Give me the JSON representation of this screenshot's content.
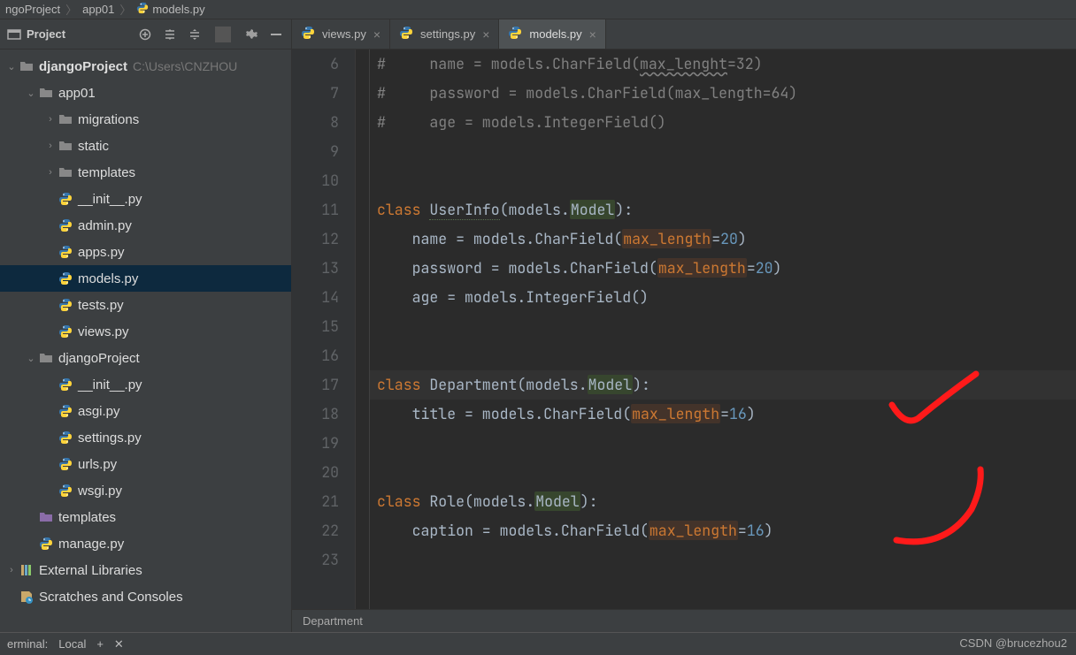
{
  "breadcrumb": {
    "project": "ngoProject",
    "folder": "app01",
    "file": "models.py"
  },
  "sidebar": {
    "title": "Project",
    "root": "djangoProject",
    "root_path": "C:\\Users\\CNZHOU",
    "items": [
      {
        "label": "djangoProject",
        "type": "folder",
        "indent": 0,
        "arrow": "v",
        "bold": true
      },
      {
        "label": "app01",
        "type": "folder",
        "indent": 1,
        "arrow": "v"
      },
      {
        "label": "migrations",
        "type": "folder",
        "indent": 2,
        "arrow": ">"
      },
      {
        "label": "static",
        "type": "folder",
        "indent": 2,
        "arrow": ">"
      },
      {
        "label": "templates",
        "type": "folder",
        "indent": 2,
        "arrow": ">"
      },
      {
        "label": "__init__.py",
        "type": "py",
        "indent": 2
      },
      {
        "label": "admin.py",
        "type": "py",
        "indent": 2
      },
      {
        "label": "apps.py",
        "type": "py",
        "indent": 2
      },
      {
        "label": "models.py",
        "type": "py",
        "indent": 2,
        "selected": true
      },
      {
        "label": "tests.py",
        "type": "py",
        "indent": 2
      },
      {
        "label": "views.py",
        "type": "py",
        "indent": 2
      },
      {
        "label": "djangoProject",
        "type": "folder",
        "indent": 1,
        "arrow": "v"
      },
      {
        "label": "__init__.py",
        "type": "py",
        "indent": 2
      },
      {
        "label": "asgi.py",
        "type": "py",
        "indent": 2
      },
      {
        "label": "settings.py",
        "type": "py",
        "indent": 2
      },
      {
        "label": "urls.py",
        "type": "py",
        "indent": 2
      },
      {
        "label": "wsgi.py",
        "type": "py",
        "indent": 2
      },
      {
        "label": "templates",
        "type": "dir",
        "indent": 1
      },
      {
        "label": "manage.py",
        "type": "py",
        "indent": 1
      },
      {
        "label": "External Libraries",
        "type": "lib",
        "indent": 0,
        "arrow": ">"
      },
      {
        "label": "Scratches and Consoles",
        "type": "scratch",
        "indent": 0
      }
    ]
  },
  "tabs": [
    {
      "label": "views.py",
      "active": false
    },
    {
      "label": "settings.py",
      "active": false
    },
    {
      "label": "models.py",
      "active": true
    }
  ],
  "gutter_start": 6,
  "gutter_end": 23,
  "code_lines": {
    "6": "#     name = models.CharField(max_lenght=32)",
    "7": "#     password = models.CharField(max_length=64)",
    "8": "#     age = models.IntegerField()",
    "9": "",
    "10": "",
    "11": "class UserInfo(models.Model):",
    "12": "    name = models.CharField(max_length=20)",
    "13": "    password = models.CharField(max_length=20)",
    "14": "    age = models.IntegerField()",
    "15": "",
    "16": "",
    "17": "class Department(models.Model):",
    "18": "    title = models.CharField(max_length=16)",
    "19": "",
    "20": "",
    "21": "class Role(models.Model):",
    "22": "    caption = models.CharField(max_length=16)",
    "23": ""
  },
  "breadcrumb_bottom": "Department",
  "status": {
    "terminal": "erminal:",
    "local": "Local",
    "plus": "+",
    "x": "✕"
  },
  "watermark": "CSDN @brucezhou2"
}
